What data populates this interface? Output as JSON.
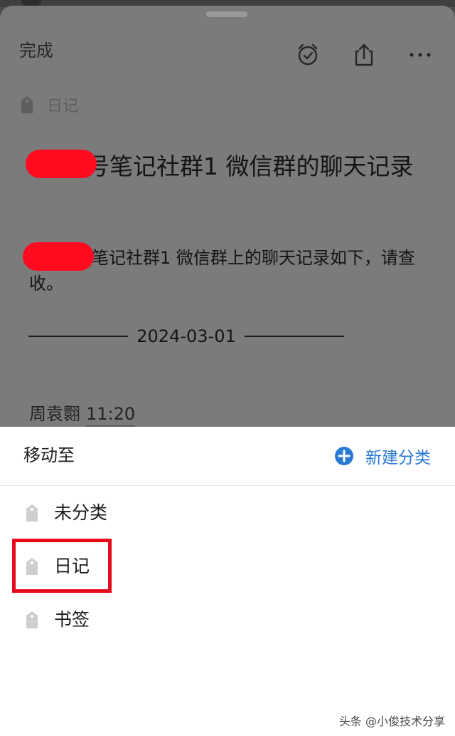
{
  "note": {
    "done_label": "完成",
    "category": "日记",
    "title": "号笔记社群1 微信群的聊天记录",
    "body": "笔记社群1 微信群上的聊天记录如下，请查收。",
    "date": "2024-03-01",
    "sender_name": "周袁翾",
    "sender_time": "11:20",
    "icons": {
      "alarm": "alarm-icon",
      "share": "share-icon",
      "more": "more-icon",
      "tag": "tag-icon"
    }
  },
  "move_sheet": {
    "title": "移动至",
    "new_category_label": "新建分类",
    "categories": [
      {
        "label": "未分类",
        "icon": "tag-icon"
      },
      {
        "label": "日记",
        "icon": "tag-icon"
      },
      {
        "label": "书签",
        "icon": "tag-icon"
      }
    ],
    "selected_index": 1
  },
  "watermark": "头条 @小俊技术分享",
  "colors": {
    "accent": "#2a7ad4",
    "highlight": "#e60b1c",
    "redaction": "#ff0a1e",
    "overlay": "#7b7b7b"
  }
}
